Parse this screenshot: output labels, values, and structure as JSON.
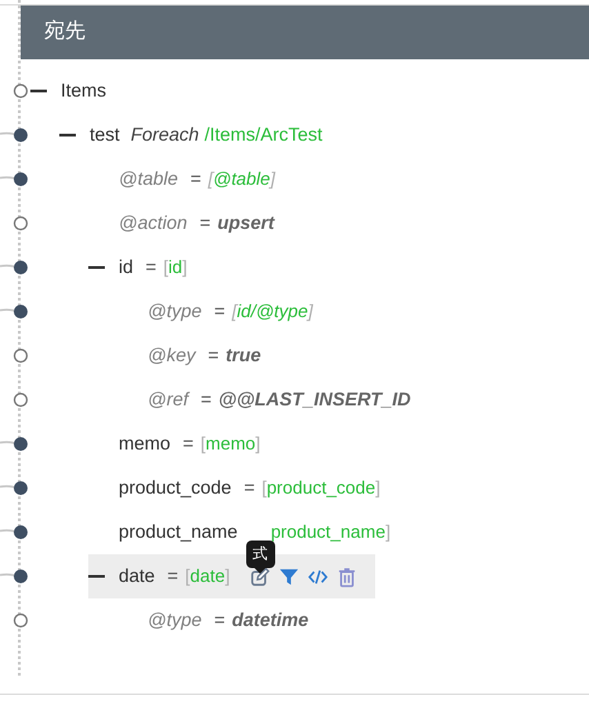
{
  "header": {
    "title": "宛先"
  },
  "tree": [
    {
      "name": "Items",
      "attribute": false,
      "connected": false,
      "expanded": true,
      "selected": false,
      "children": [
        {
          "name": "test",
          "attribute": false,
          "connected": true,
          "expanded": true,
          "selected": false,
          "mode": "Foreach",
          "path": "/Items/ArcTest",
          "children": [
            {
              "name": "@table",
              "attribute": true,
              "connected": true,
              "selected": false,
              "op": "=",
              "value": {
                "kind": "mapping",
                "text": "[@table]"
              }
            },
            {
              "name": "@action",
              "attribute": true,
              "connected": false,
              "selected": false,
              "op": "=",
              "value": {
                "kind": "literal",
                "text": "upsert"
              }
            },
            {
              "name": "id",
              "attribute": false,
              "connected": true,
              "expanded": true,
              "selected": false,
              "op": "=",
              "value": {
                "kind": "mapping",
                "text": "[id]"
              },
              "children": [
                {
                  "name": "@type",
                  "attribute": true,
                  "connected": true,
                  "selected": false,
                  "op": "=",
                  "value": {
                    "kind": "mapping",
                    "text": "[id/@type]"
                  }
                },
                {
                  "name": "@key",
                  "attribute": true,
                  "connected": false,
                  "selected": false,
                  "op": "=",
                  "value": {
                    "kind": "literal",
                    "text": "true"
                  }
                },
                {
                  "name": "@ref",
                  "attribute": true,
                  "connected": false,
                  "selected": false,
                  "op": "=",
                  "value": {
                    "kind": "literal",
                    "text": "@@LAST_INSERT_ID"
                  }
                }
              ]
            },
            {
              "name": "memo",
              "attribute": false,
              "connected": true,
              "selected": false,
              "op": "=",
              "value": {
                "kind": "mapping",
                "text": "[memo]"
              }
            },
            {
              "name": "product_code",
              "attribute": false,
              "connected": true,
              "selected": false,
              "op": "=",
              "value": {
                "kind": "mapping",
                "text": "[product_code]"
              }
            },
            {
              "name": "product_name",
              "attribute": false,
              "connected": true,
              "selected": false,
              "value": {
                "kind": "mapping",
                "text": "product_name]"
              }
            },
            {
              "name": "date",
              "attribute": false,
              "connected": true,
              "expanded": true,
              "selected": true,
              "op": "=",
              "value": {
                "kind": "mapping",
                "text": "[date]"
              },
              "tooltip": "式",
              "children": [
                {
                  "name": "@type",
                  "attribute": true,
                  "connected": false,
                  "selected": false,
                  "op": "=",
                  "value": {
                    "kind": "literal",
                    "text": "datetime"
                  }
                }
              ]
            }
          ]
        }
      ]
    }
  ]
}
